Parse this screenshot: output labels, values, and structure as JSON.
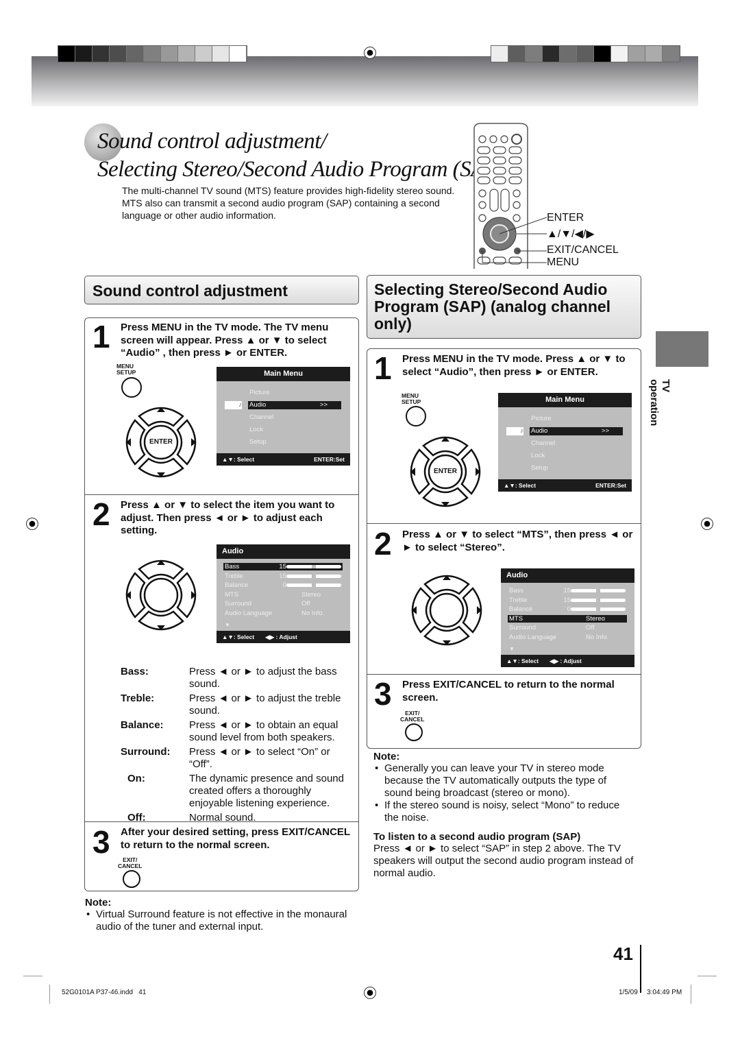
{
  "header": {
    "swatches_left": [
      "#000000",
      "#1a1a1a",
      "#333333",
      "#4d4d4d",
      "#666666",
      "#808080",
      "#999999",
      "#b3b3b3",
      "#cccccc",
      "#e6e6e6",
      "#ffffff"
    ],
    "swatches_right": [
      "#eeeeee",
      "#5e5e5e",
      "#7d7d7d",
      "#2a2a2a",
      "#6d6d6d",
      "#5e5e5e",
      "#000000",
      "#f2f2f2",
      "#a0a0a0",
      "#ababab",
      "#808080"
    ]
  },
  "title": {
    "line1": "Sound control adjustment/",
    "line2": "Selecting Stereo/Second Audio Program (SAP)"
  },
  "intro": "The multi-channel TV sound (MTS) feature provides high-fidelity stereo sound. MTS also can transmit a second audio program (SAP) containing a second language or other audio information.",
  "remote_labels": {
    "enter": "ENTER",
    "arrows": "▲/▼/◀/▶",
    "exit": "EXIT/CANCEL",
    "menu": "MENU"
  },
  "left": {
    "heading": "Sound control adjustment",
    "step1": {
      "num": "1",
      "text": "Press MENU in the TV mode. The TV menu screen will appear. Press ▲ or ▼ to select “Audio” , then press ► or ENTER."
    },
    "step2": {
      "num": "2",
      "text": "Press ▲ or ▼ to select the item you want to adjust. Then press ◄ or ► to adjust each setting."
    },
    "step3": {
      "num": "3",
      "text": "After your desired setting, press EXIT/CANCEL to return to the normal screen."
    },
    "definitions": [
      {
        "term": "Bass:",
        "desc": "Press ◄ or ► to adjust the bass sound."
      },
      {
        "term": "Treble:",
        "desc": "Press ◄ or ► to adjust the treble sound."
      },
      {
        "term": "Balance:",
        "desc": "Press ◄ or ► to obtain an equal sound level from both speakers."
      },
      {
        "term": "Surround:",
        "desc": "Press ◄ or ► to select “On” or “Off”."
      },
      {
        "term": "On:",
        "desc": "The dynamic presence and sound created offers a thoroughly enjoyable listening experience."
      },
      {
        "term": "Off:",
        "desc": "Normal sound."
      }
    ],
    "note_title": "Note:",
    "notes": [
      "Virtual Surround feature is not effective in the monaural audio of the tuner and external input."
    ]
  },
  "right": {
    "heading": "Selecting Stereo/Second Audio Program (SAP) (analog channel only)",
    "step1": {
      "num": "1",
      "text": "Press MENU in the TV mode. Press ▲ or ▼ to select “Audio”, then press ► or ENTER."
    },
    "step2": {
      "num": "2",
      "text": "Press ▲ or ▼ to select “MTS”, then press ◄ or ► to select “Stereo”."
    },
    "step3": {
      "num": "3",
      "text": "Press EXIT/CANCEL to return to the normal screen."
    },
    "note_title": "Note:",
    "notes": [
      "Generally you can leave your TV in stereo mode because the TV automatically outputs the type of sound being broadcast (stereo or mono).",
      "If the stereo sound is noisy, select “Mono” to reduce the noise."
    ],
    "sap_title": "To listen to a second audio program (SAP)",
    "sap_text": "Press ◄ or ► to select “SAP” in step 2 above. The TV speakers will output the second audio program instead of normal audio."
  },
  "buttons": {
    "menu_setup_1": "MENU",
    "menu_setup_2": "SETUP",
    "exit_1": "EXIT/",
    "exit_2": "CANCEL",
    "enter": "ENTER"
  },
  "main_menu": {
    "title": "Main Menu",
    "items": [
      "Picture",
      "Audio",
      "Channel",
      "Lock",
      "Setup"
    ],
    "arrow": ">>",
    "footer_left": "▲▼: Select",
    "footer_right": "ENTER:Set"
  },
  "audio_menu": {
    "title": "Audio",
    "rows": [
      {
        "label": "Bass",
        "value": "15",
        "level": 0.5
      },
      {
        "label": "Treble",
        "value": "15",
        "level": 0.5
      },
      {
        "label": "Balance",
        "value": "0",
        "level": 0.5
      },
      {
        "label": "MTS",
        "value": "Stereo"
      },
      {
        "label": "Surround",
        "value": "Off"
      },
      {
        "label": "Audio Language",
        "value": "No Info."
      }
    ],
    "footer_left": "▲▼: Select",
    "footer_right": "◀▶ : Adjust"
  },
  "side_tab": "TV operation",
  "page_number": "41",
  "footer": {
    "file": "52G0101A P37-46.indd   41",
    "date": "1/5/09",
    "time": "3:04:49 PM"
  }
}
